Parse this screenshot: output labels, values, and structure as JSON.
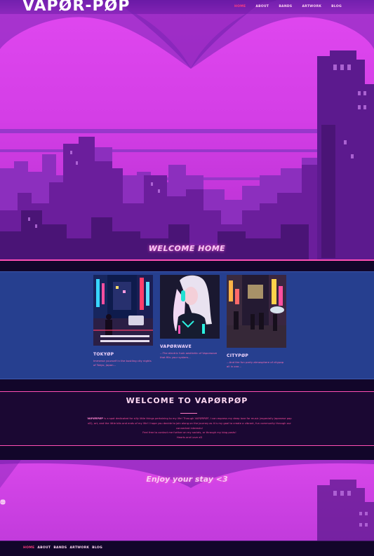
{
  "header": {
    "logo": "VAPØR-PØP",
    "nav": [
      {
        "label": "HOME",
        "active": true
      },
      {
        "label": "ABOUT",
        "active": false
      },
      {
        "label": "BANDS",
        "active": false
      },
      {
        "label": "ARTWORK",
        "active": false
      },
      {
        "label": "BLOG",
        "active": false
      }
    ]
  },
  "hero": {
    "title": "WELCOME HOME"
  },
  "cards": [
    {
      "title": "TOKYØP",
      "description": "Immerse yourself in the bustling city nights of Tokyo, Japan..."
    },
    {
      "title": "VAPØRWAVE",
      "description": "...The electric funk aesthetic of Vaporwave that fills your system..."
    },
    {
      "title": "CITYPØP",
      "description": "...And the fun party atmosphere of citypop all in one..."
    }
  ],
  "intro": {
    "title": "WELCOME TO VAPØRPØP",
    "brand": "VAPØRPØP",
    "line1": "is a spot dedicated for silly little things pertaining to my life! Through VAPØRPØP, I can express my deep",
    "line2": "love for music (especially Japanese pop xD), art, and the little bits and ends of my life! I hope you decide to join along on",
    "line3": "the journey as it is my goal to create a vibrant, fun community through our connected interests!",
    "line4": "Feel free to contact me further on my socials, or through my blog posts!",
    "line5": "Hearts and Love xD"
  },
  "footer": {
    "tagline": "Enjoy your stay <3",
    "socials": [
      "instagram-icon",
      "discord-icon",
      "pinterest-icon",
      "tumblr-icon"
    ]
  },
  "colors": {
    "accent": "#ff4fb4",
    "hero_pink": "#e048f0",
    "card_bg": "#263f8f",
    "dark_bg": "#12062a"
  }
}
